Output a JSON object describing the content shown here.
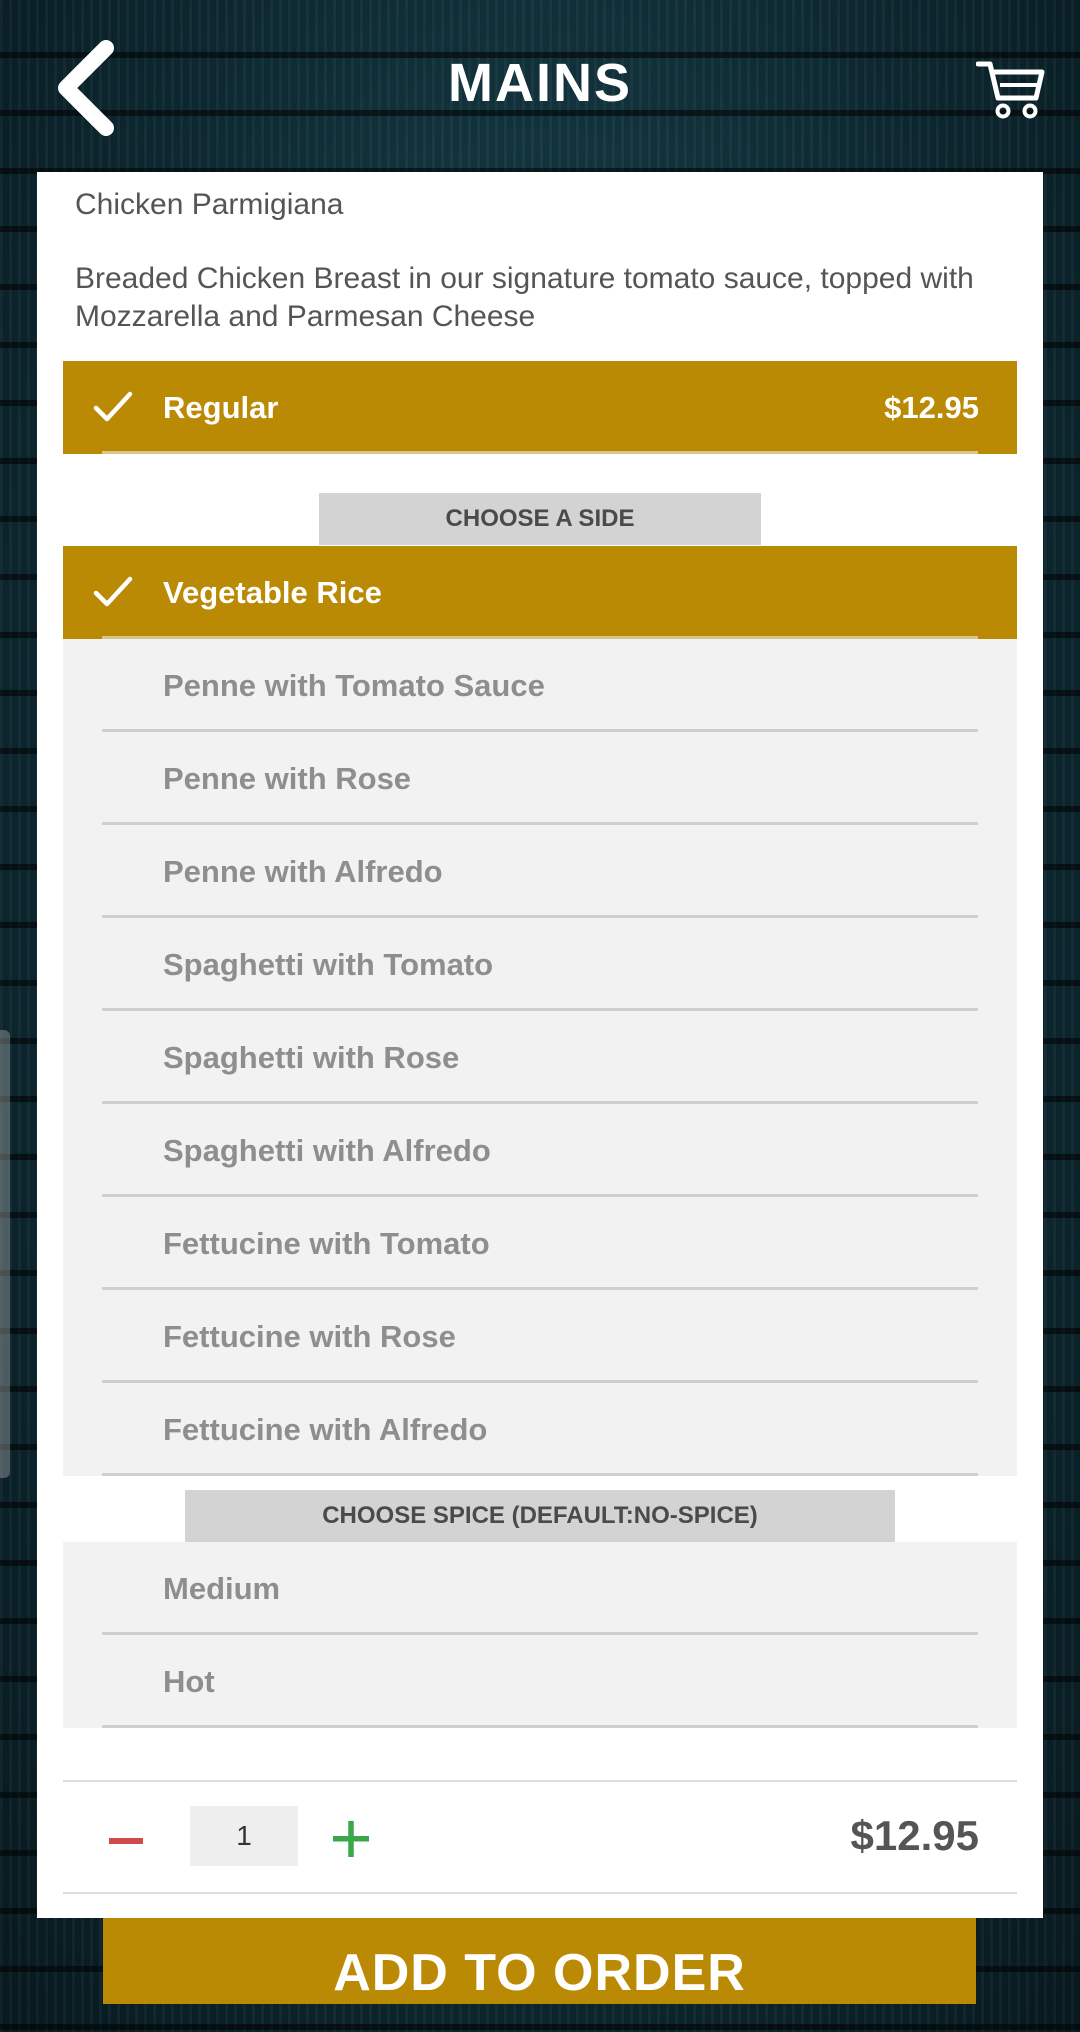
{
  "header": {
    "title": "MAINS",
    "back_icon": "chevron-left-icon",
    "cart_icon": "shopping-cart-icon"
  },
  "item": {
    "name": "Chicken Parmigiana",
    "description": "Breaded Chicken Breast in our signature tomato sauce, topped with Mozzarella and Parmesan Cheese"
  },
  "size_option": {
    "label": "Regular",
    "price": "$12.95",
    "selected": true
  },
  "side_section": {
    "title": "CHOOSE A SIDE",
    "options": [
      {
        "label": "Vegetable Rice",
        "selected": true
      },
      {
        "label": "Penne with Tomato Sauce",
        "selected": false
      },
      {
        "label": "Penne with Rose",
        "selected": false
      },
      {
        "label": "Penne with Alfredo",
        "selected": false
      },
      {
        "label": "Spaghetti with Tomato",
        "selected": false
      },
      {
        "label": "Spaghetti with Rose",
        "selected": false
      },
      {
        "label": "Spaghetti with Alfredo",
        "selected": false
      },
      {
        "label": "Fettucine with Tomato",
        "selected": false
      },
      {
        "label": "Fettucine with Rose",
        "selected": false
      },
      {
        "label": "Fettucine with Alfredo",
        "selected": false
      }
    ]
  },
  "spice_section": {
    "title": "CHOOSE SPICE (DEFAULT:NO-SPICE)",
    "options": [
      {
        "label": "Medium",
        "selected": false
      },
      {
        "label": "Hot",
        "selected": false
      }
    ]
  },
  "quantity": {
    "value": "1",
    "minus_icon": "minus-icon",
    "plus_icon": "plus-icon"
  },
  "total": "$12.95",
  "add_button": "ADD TO ORDER",
  "colors": {
    "accent": "#bb8a05",
    "minus": "#cf4a4a",
    "plus": "#3aa84a",
    "option_bg": "#f2f2f2",
    "section_head_bg": "#d3d3d3"
  }
}
